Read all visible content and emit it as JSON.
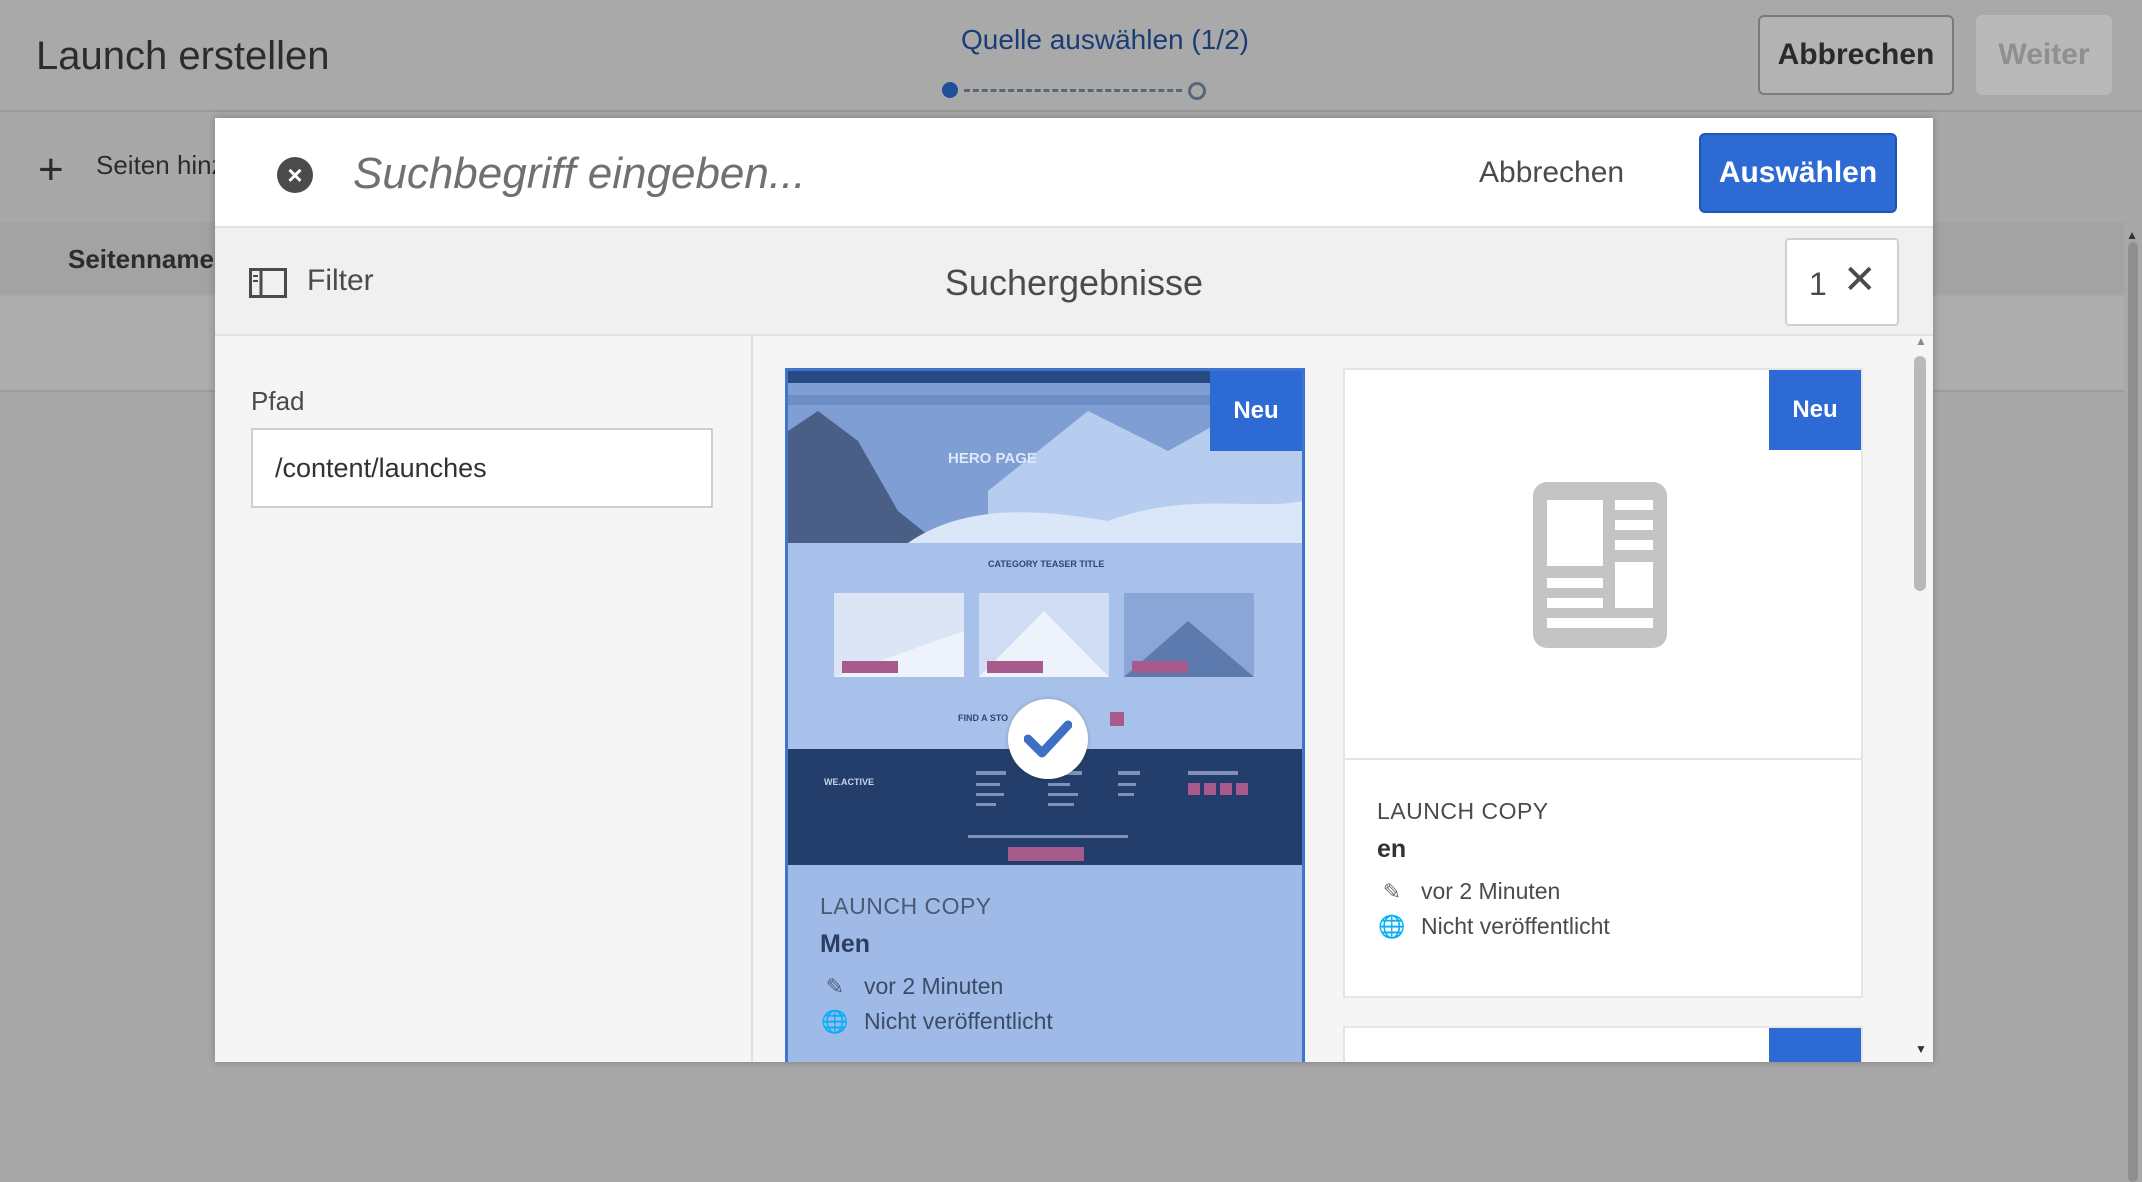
{
  "header": {
    "title": "Launch erstellen",
    "step_label": "Quelle auswählen (1/2)",
    "cancel_label": "Abbrechen",
    "next_label": "Weiter"
  },
  "toolbar": {
    "add_pages_label": "Seiten hinz",
    "column_header": "Seitenname"
  },
  "modal": {
    "search_placeholder": "Suchbegriff eingeben...",
    "cancel_label": "Abbrechen",
    "select_label": "Auswählen",
    "filter_label": "Filter",
    "results_title": "Suchergebnisse",
    "selected_count": "1",
    "path_label": "Pfad",
    "path_value": "/content/launches",
    "cards": [
      {
        "badge": "Neu",
        "kind": "LAUNCH COPY",
        "name": "Men",
        "modified": "vor 2 Minuten",
        "status": "Nicht veröffentlicht",
        "selected": true,
        "thumbnail": {
          "hero_label": "HERO PAGE",
          "teaser_title": "CATEGORY TEASER TITLE",
          "find_label": "FIND A STO",
          "footer_logo": "WE.ACTIVE"
        }
      },
      {
        "badge": "Neu",
        "kind": "LAUNCH COPY",
        "name": "en",
        "modified": "vor 2 Minuten",
        "status": "Nicht veröffentlicht",
        "selected": false,
        "thumbnail_icon": "page-document-icon"
      },
      {
        "selected": false
      }
    ]
  },
  "colors": {
    "accent": "#2d6ad3",
    "selected_overlay": "#9fbae6",
    "dim_background": "#a8a8a8"
  }
}
